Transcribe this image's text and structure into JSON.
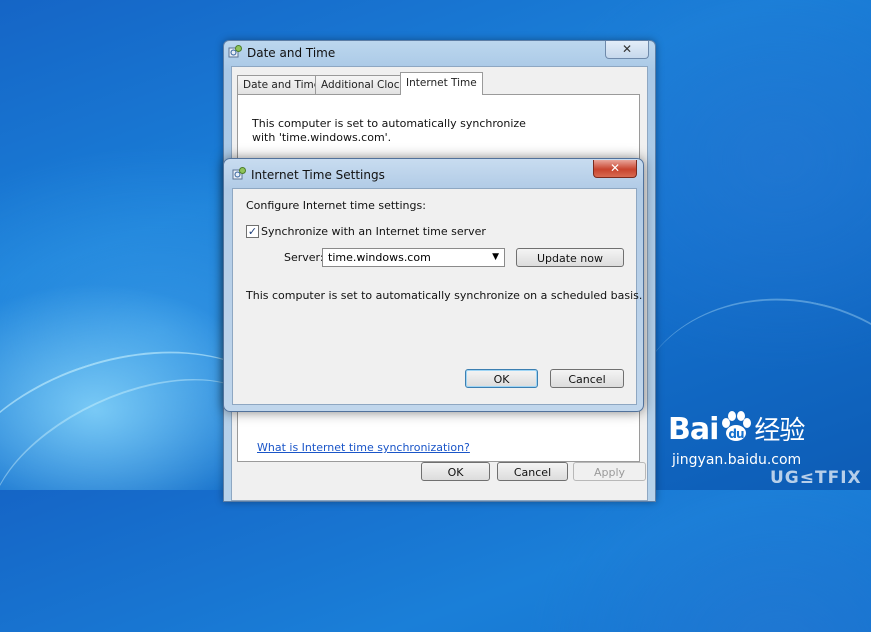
{
  "main_window": {
    "title": "Date and Time",
    "close_glyph": "✕",
    "tabs": [
      {
        "label": "Date and Time",
        "active": false
      },
      {
        "label": "Additional Clocks",
        "active": false
      },
      {
        "label": "Internet Time",
        "active": true
      }
    ],
    "status_text": "This computer is set to automatically synchronize with 'time.windows.com'.",
    "help_link": "What is Internet time synchronization?",
    "buttons": {
      "ok": "OK",
      "cancel": "Cancel",
      "apply": "Apply"
    }
  },
  "dialog": {
    "title": "Internet Time Settings",
    "close_glyph": "✕",
    "heading": "Configure Internet time settings:",
    "sync_checkbox": {
      "label": "Synchronize with an Internet time server",
      "checked": true,
      "mark": "✓"
    },
    "server_label": "Server:",
    "server_value": "time.windows.com",
    "dropdown_glyph": "▼",
    "update_button": "Update now",
    "status_text": "This computer is set to automatically synchronize on a scheduled basis.",
    "buttons": {
      "ok": "OK",
      "cancel": "Cancel"
    }
  },
  "watermark": {
    "brand": "Bai",
    "brand_suffix": "经验",
    "site": "jingyan.baidu.com",
    "corner": "UG≤TFIX"
  },
  "icons": [
    "clock-settings-icon",
    "close-icon",
    "checkbox-check-icon",
    "dropdown-arrow-icon",
    "baidu-paw-icon"
  ]
}
